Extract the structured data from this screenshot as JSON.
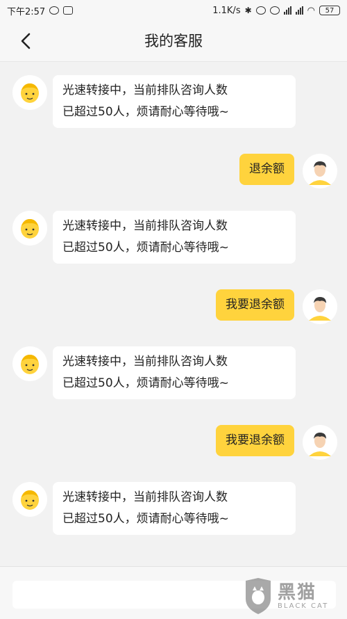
{
  "status_bar": {
    "time": "下午2:57",
    "speed": "1.1K/s",
    "battery": "57"
  },
  "nav": {
    "title": "我的客服"
  },
  "messages": [
    {
      "side": "left",
      "line1": "光速转接中，当前排队咨询人数",
      "line2": "已超过50人，烦请耐心等待哦~"
    },
    {
      "side": "right",
      "text": "退余额"
    },
    {
      "side": "left",
      "line1": "光速转接中，当前排队咨询人数",
      "line2": "已超过50人，烦请耐心等待哦~"
    },
    {
      "side": "right",
      "text": "我要退余额"
    },
    {
      "side": "left",
      "line1": "光速转接中，当前排队咨询人数",
      "line2": "已超过50人，烦请耐心等待哦~"
    },
    {
      "side": "right",
      "text": "我要退余额"
    },
    {
      "side": "left",
      "line1": "光速转接中，当前排队咨询人数",
      "line2": "已超过50人，烦请耐心等待哦~"
    }
  ],
  "input": {
    "value": ""
  },
  "watermark": {
    "cn": "黑猫",
    "en": "BLACK CAT"
  },
  "colors": {
    "user_bubble": "#ffd33d",
    "agent_bubble": "#ffffff",
    "background": "#f2f2f2"
  }
}
